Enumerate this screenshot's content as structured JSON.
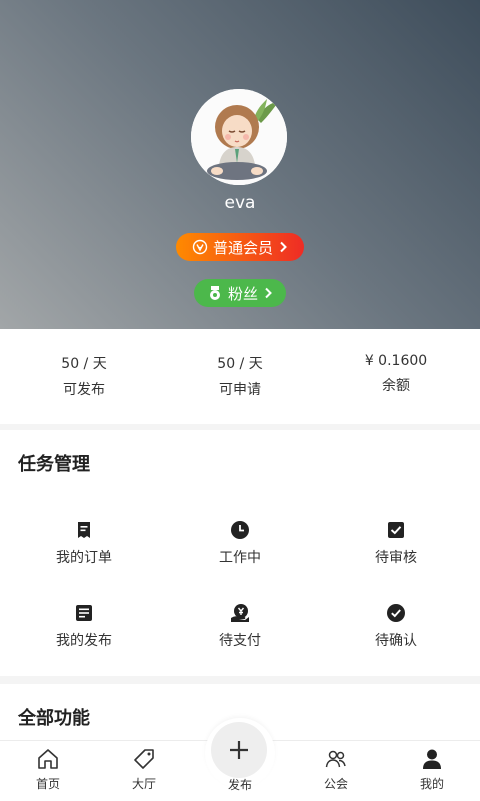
{
  "profile": {
    "username": "eva",
    "member_label": "普通会员",
    "fans_label": "粉丝"
  },
  "stats": [
    {
      "value": "50 / 天",
      "label": "可发布"
    },
    {
      "value": "50 / 天",
      "label": "可申请"
    },
    {
      "value": "¥ 0.1600",
      "label": "余额"
    }
  ],
  "task_management": {
    "title": "任务管理",
    "items": [
      {
        "label": "我的订单",
        "icon": "receipt-icon"
      },
      {
        "label": "工作中",
        "icon": "clock-icon"
      },
      {
        "label": "待审核",
        "icon": "checkbox-icon"
      },
      {
        "label": "我的发布",
        "icon": "document-icon"
      },
      {
        "label": "待支付",
        "icon": "payment-icon"
      },
      {
        "label": "待确认",
        "icon": "check-circle-icon"
      }
    ]
  },
  "all_functions": {
    "title": "全部功能"
  },
  "tabbar": {
    "tabs": [
      {
        "label": "首页",
        "icon": "home-icon"
      },
      {
        "label": "大厅",
        "icon": "tag-icon"
      },
      {
        "label": "发布",
        "icon": "plus-icon"
      },
      {
        "label": "公会",
        "icon": "group-icon"
      },
      {
        "label": "我的",
        "icon": "user-icon"
      }
    ]
  },
  "colors": {
    "member_gradient_start": "#ff8a00",
    "member_gradient_end": "#ee2c25",
    "fans_green": "#4cb84b",
    "header_dark": "#3e4d5b",
    "header_light": "#a2a6a8"
  }
}
